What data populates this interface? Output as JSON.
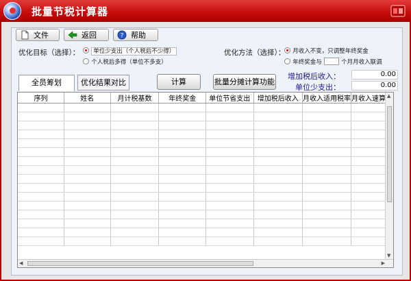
{
  "window": {
    "title": "批量节税计算器"
  },
  "toolbar": {
    "file_label": "文件",
    "back_label": "返回",
    "help_label": "帮助"
  },
  "optimize_target": {
    "label": "优化目标（选择）：",
    "options": [
      {
        "text": "单位少支出（个人税后不少得）",
        "selected": true
      },
      {
        "text": "个人税后多得（单位不多支）",
        "selected": false
      }
    ]
  },
  "optimize_method": {
    "label": "优化方法（选择）：",
    "options": [
      {
        "text": "月收入不变，只调整年终奖金",
        "selected": true
      },
      {
        "text_before": "年终奖金与",
        "text_after": "个月月收入联调",
        "selected": false
      }
    ]
  },
  "tabs": [
    {
      "label": "全员筹划",
      "active": true
    },
    {
      "label": "优化结果对比",
      "active": false
    }
  ],
  "buttons": {
    "calc_label": "计算",
    "batch_label": "批量分摊计算功能"
  },
  "summary": {
    "income_label": "增加税后收入：",
    "income_value": "0.00",
    "cost_label": "单位少支出：",
    "cost_value": "0.00"
  },
  "table": {
    "columns": [
      "序列",
      "姓名",
      "月计税基数",
      "年终奖金",
      "单位节省支出",
      "增加税后收入",
      "月收入适用税率",
      "月收入速算扣"
    ]
  },
  "colors": {
    "titlebar": "#c80d0d",
    "accent_text": "#1a1a8a"
  },
  "icons": [
    "app-logo-icon",
    "document-icon",
    "green-left-arrow-icon",
    "help-icon",
    "window-menu-icon"
  ]
}
